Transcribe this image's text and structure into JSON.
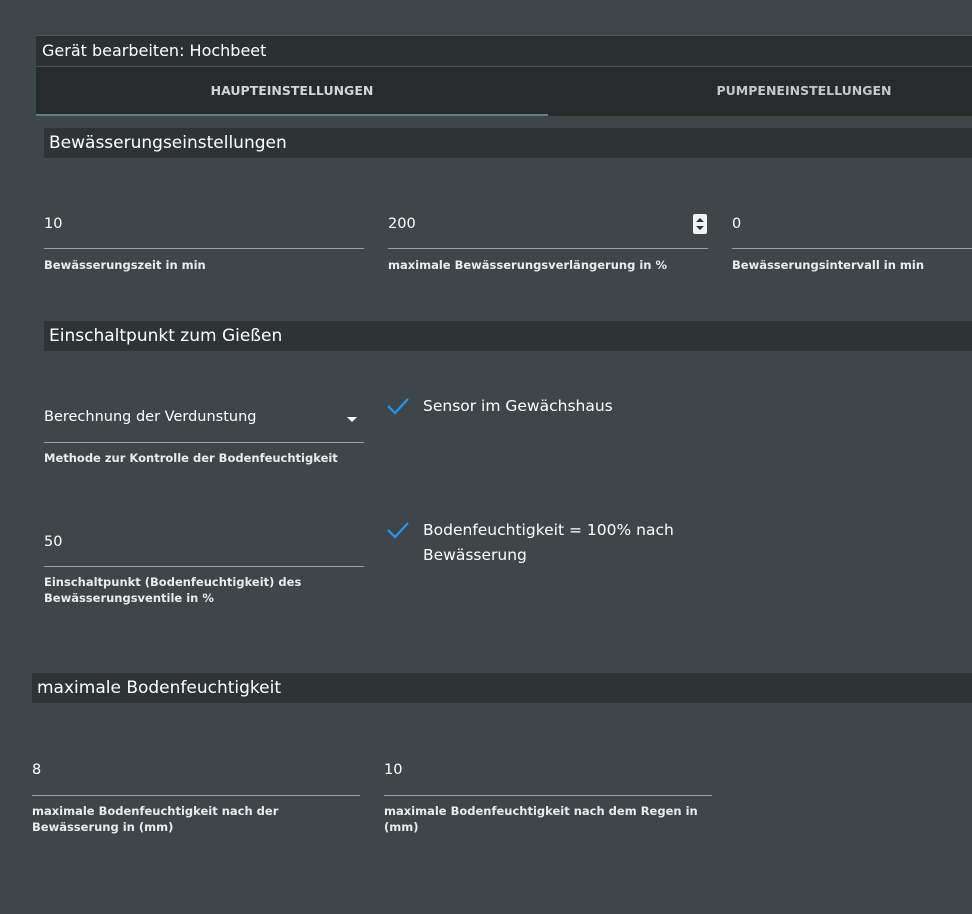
{
  "dialog": {
    "title": "Gerät bearbeiten: Hochbeet"
  },
  "tabs": [
    {
      "label": "HAUPTEINSTELLUNGEN",
      "active": true
    },
    {
      "label": "PUMPENEINSTELLUNGEN",
      "active": false
    }
  ],
  "section_irrigation": {
    "title": "Bewässerungseinstellungen",
    "fields": [
      {
        "value": "10",
        "helper": "Bewässerungszeit in min"
      },
      {
        "value": "200",
        "helper": "maximale Bewässerungsverlängerung in %"
      },
      {
        "value": "0",
        "helper": "Bewässerungsintervall in min"
      }
    ]
  },
  "section_switchpoint": {
    "title": "Einschaltpunkt zum Gießen",
    "method_select": {
      "value": "Berechnung der Verdunstung",
      "helper": "Methode zur Kontrolle der Bodenfeuchtigkeit"
    },
    "sensor_checkbox": {
      "label": "Sensor im Gewächshaus",
      "checked": true
    },
    "threshold_field": {
      "value": "50",
      "helper": "Einschaltpunkt (Bodenfeuchtigkeit) des Bewässerungsventile in %"
    },
    "moisture_checkbox": {
      "label": "Bodenfeuchtigkeit = 100% nach Bewässerung",
      "checked": true
    }
  },
  "section_max_moisture": {
    "title": "maximale Bodenfeuchtigkeit",
    "fields": [
      {
        "value": "8",
        "helper": "maximale Bodenfeuchtigkeit nach der Bewässerung in (mm)"
      },
      {
        "value": "10",
        "helper": "maximale Bodenfeuchtigkeit nach dem Regen in (mm)"
      }
    ]
  },
  "colors": {
    "background": "#3f4649",
    "header_bar": "#2e3436",
    "tab_bar": "#282a2b",
    "accent": "#2196f3"
  }
}
